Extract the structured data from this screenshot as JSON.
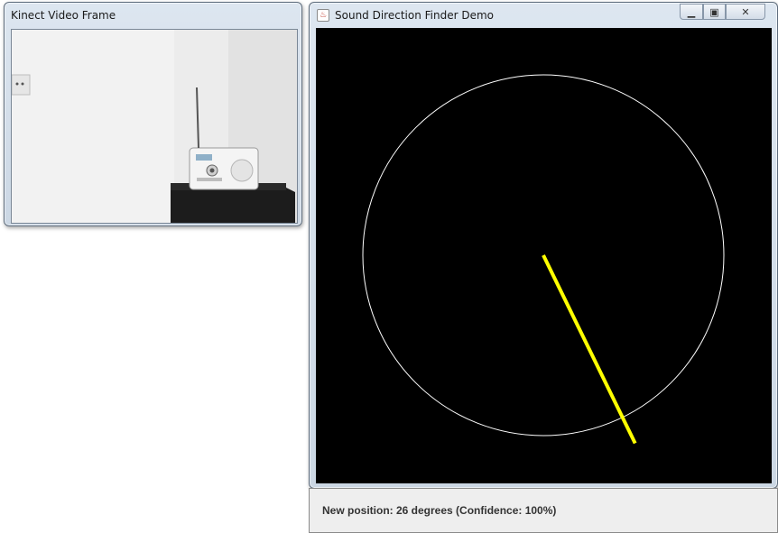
{
  "kinect_window": {
    "title": "Kinect Video Frame"
  },
  "finder_window": {
    "title": "Sound Direction Finder Demo",
    "controls": {
      "minimize": "minimize-icon",
      "maximize": "maximize-icon",
      "close": "close-icon"
    },
    "direction_degrees": 26,
    "colors": {
      "background": "#000000",
      "circle": "#ffffff",
      "pointer": "#ffff00"
    }
  },
  "status": {
    "text": "New position: 26 degrees (Confidence: 100%)"
  }
}
